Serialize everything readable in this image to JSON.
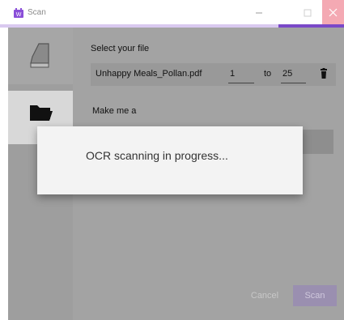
{
  "window": {
    "title": "Scan",
    "close_label": "✕",
    "minimize_label": "—",
    "maximize_label": "☐"
  },
  "colors": {
    "accent": "#7a49c8",
    "accent_light": "#d9c9f0",
    "close_hover": "#f4a9b3"
  },
  "sidebar": {
    "items": [
      {
        "icon": "scanner-icon"
      },
      {
        "icon": "folder-icon"
      }
    ]
  },
  "main": {
    "select_file_label": "Select your file",
    "file_name": "Unhappy Meals_Pollan.pdf",
    "page_from": "1",
    "to_label": "to",
    "page_to": "25",
    "delete_icon": "trash-icon",
    "make_label": "Make me a"
  },
  "buttons": {
    "cancel": "Cancel",
    "scan": "Scan"
  },
  "modal": {
    "message": "OCR scanning in progress..."
  }
}
